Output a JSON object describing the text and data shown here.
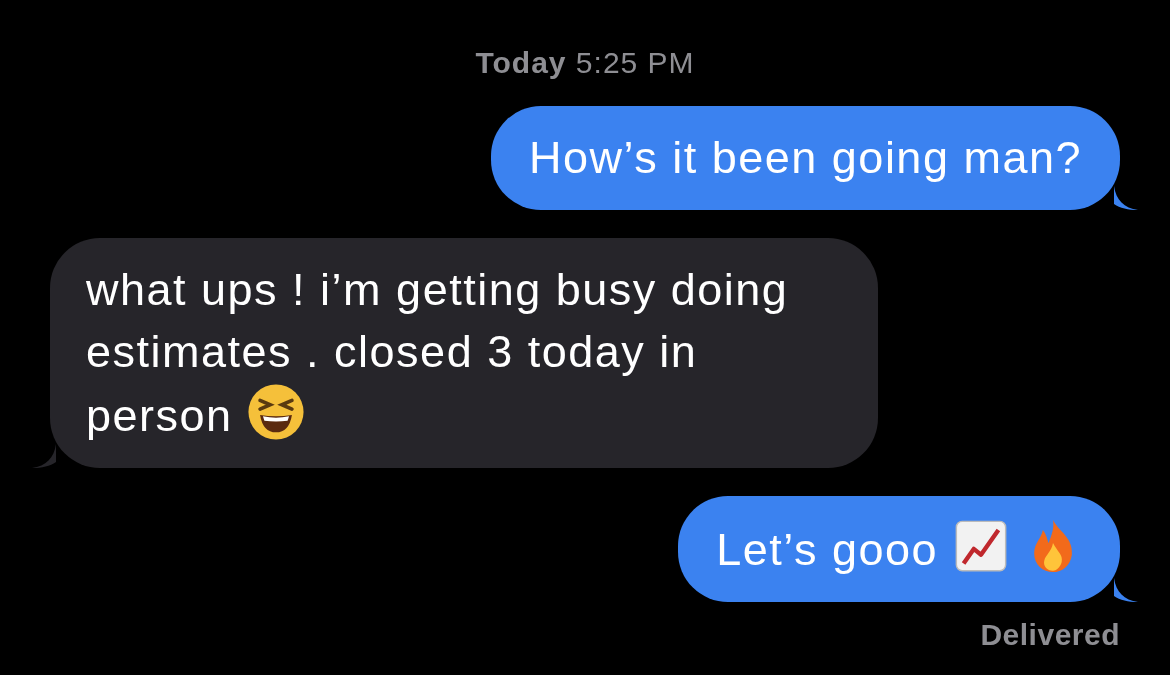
{
  "timestamp": "**Today** 5:25 PM",
  "messages": [
    {
      "kind": "sent",
      "text": "How’s it been going man?"
    },
    {
      "kind": "received",
      "text": "what ups ! i’m getting busy doing estimates . closed 3 today in person",
      "emoji": [
        {
          "kind": "laughing"
        }
      ]
    },
    {
      "kind": "sent",
      "text": "Let’s gooo",
      "emoji": [
        {
          "kind": "chart"
        },
        {
          "kind": "fire"
        }
      ]
    }
  ],
  "status": "Delivered"
}
